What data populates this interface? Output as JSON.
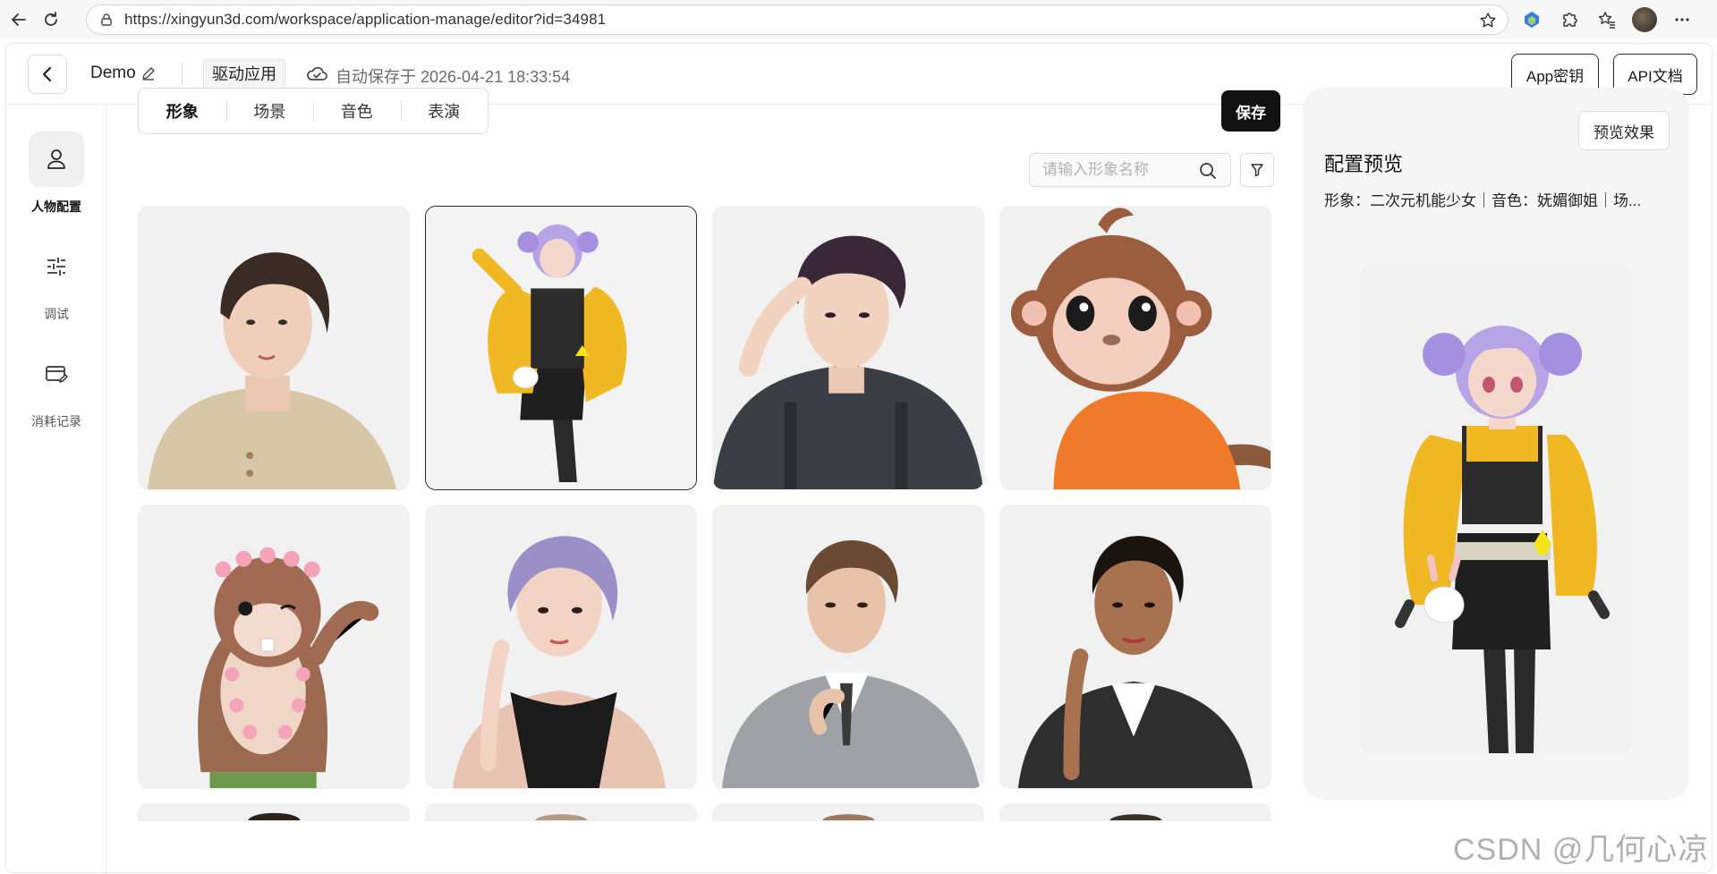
{
  "browser": {
    "url": "https://xingyun3d.com/workspace/application-manage/editor?id=34981",
    "icons": [
      "back-arrow-icon",
      "reload-icon",
      "site-info-icon",
      "favorite-star-icon",
      "extension-icon",
      "puzzle-icon",
      "collections-icon",
      "profile-avatar",
      "more-icon"
    ]
  },
  "header": {
    "app_name": "Demo",
    "tag": "驱动应用",
    "autosave": "自动保存于 2026-04-21 18:33:54",
    "app_key_label": "App密钥",
    "api_docs_label": "API文档"
  },
  "sidebar": {
    "items": [
      {
        "label": "人物配置",
        "icon": "person-icon",
        "active": true
      },
      {
        "label": "调试",
        "icon": "sliders-icon",
        "active": false
      },
      {
        "label": "消耗记录",
        "icon": "card-edit-icon",
        "active": false
      }
    ]
  },
  "tabs": [
    {
      "label": "形象",
      "active": true
    },
    {
      "label": "场景",
      "active": false
    },
    {
      "label": "音色",
      "active": false
    },
    {
      "label": "表演",
      "active": false
    }
  ],
  "save_label": "保存",
  "search": {
    "placeholder": "请输入形象名称"
  },
  "avatars": [
    {
      "name": "short-hair-woman-beige-polo",
      "selected": false
    },
    {
      "name": "anime-girl-purple-hair-yellow-jacket",
      "selected": true
    },
    {
      "name": "curly-hair-young-man",
      "selected": false
    },
    {
      "name": "cartoon-monkey-orange-jacket",
      "selected": false
    },
    {
      "name": "cartoon-beaver-flower-crown",
      "selected": false
    },
    {
      "name": "purple-bob-woman-black-top",
      "selected": false
    },
    {
      "name": "man-grey-suit",
      "selected": false
    },
    {
      "name": "woman-black-leather-jacket",
      "selected": false
    }
  ],
  "preview": {
    "button_label": "预览效果",
    "title": "配置预览",
    "description": "形象：二次元机能少女｜音色：妩媚御姐｜场..."
  },
  "watermark": "CSDN @几何心凉",
  "colors": {
    "primary_button": "#111111",
    "panel_bg": "#f5f5f5",
    "card_bg": "#f1f1f1"
  }
}
